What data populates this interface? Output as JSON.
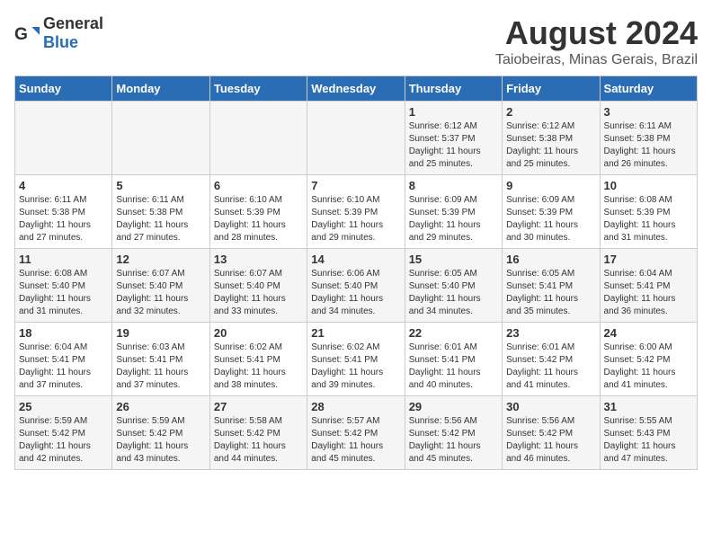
{
  "logo": {
    "general": "General",
    "blue": "Blue"
  },
  "title": {
    "month_year": "August 2024",
    "location": "Taiobeiras, Minas Gerais, Brazil"
  },
  "days_of_week": [
    "Sunday",
    "Monday",
    "Tuesday",
    "Wednesday",
    "Thursday",
    "Friday",
    "Saturday"
  ],
  "weeks": [
    [
      {
        "day": "",
        "info": ""
      },
      {
        "day": "",
        "info": ""
      },
      {
        "day": "",
        "info": ""
      },
      {
        "day": "",
        "info": ""
      },
      {
        "day": "1",
        "info": "Sunrise: 6:12 AM\nSunset: 5:37 PM\nDaylight: 11 hours\nand 25 minutes."
      },
      {
        "day": "2",
        "info": "Sunrise: 6:12 AM\nSunset: 5:38 PM\nDaylight: 11 hours\nand 25 minutes."
      },
      {
        "day": "3",
        "info": "Sunrise: 6:11 AM\nSunset: 5:38 PM\nDaylight: 11 hours\nand 26 minutes."
      }
    ],
    [
      {
        "day": "4",
        "info": "Sunrise: 6:11 AM\nSunset: 5:38 PM\nDaylight: 11 hours\nand 27 minutes."
      },
      {
        "day": "5",
        "info": "Sunrise: 6:11 AM\nSunset: 5:38 PM\nDaylight: 11 hours\nand 27 minutes."
      },
      {
        "day": "6",
        "info": "Sunrise: 6:10 AM\nSunset: 5:39 PM\nDaylight: 11 hours\nand 28 minutes."
      },
      {
        "day": "7",
        "info": "Sunrise: 6:10 AM\nSunset: 5:39 PM\nDaylight: 11 hours\nand 29 minutes."
      },
      {
        "day": "8",
        "info": "Sunrise: 6:09 AM\nSunset: 5:39 PM\nDaylight: 11 hours\nand 29 minutes."
      },
      {
        "day": "9",
        "info": "Sunrise: 6:09 AM\nSunset: 5:39 PM\nDaylight: 11 hours\nand 30 minutes."
      },
      {
        "day": "10",
        "info": "Sunrise: 6:08 AM\nSunset: 5:39 PM\nDaylight: 11 hours\nand 31 minutes."
      }
    ],
    [
      {
        "day": "11",
        "info": "Sunrise: 6:08 AM\nSunset: 5:40 PM\nDaylight: 11 hours\nand 31 minutes."
      },
      {
        "day": "12",
        "info": "Sunrise: 6:07 AM\nSunset: 5:40 PM\nDaylight: 11 hours\nand 32 minutes."
      },
      {
        "day": "13",
        "info": "Sunrise: 6:07 AM\nSunset: 5:40 PM\nDaylight: 11 hours\nand 33 minutes."
      },
      {
        "day": "14",
        "info": "Sunrise: 6:06 AM\nSunset: 5:40 PM\nDaylight: 11 hours\nand 34 minutes."
      },
      {
        "day": "15",
        "info": "Sunrise: 6:05 AM\nSunset: 5:40 PM\nDaylight: 11 hours\nand 34 minutes."
      },
      {
        "day": "16",
        "info": "Sunrise: 6:05 AM\nSunset: 5:41 PM\nDaylight: 11 hours\nand 35 minutes."
      },
      {
        "day": "17",
        "info": "Sunrise: 6:04 AM\nSunset: 5:41 PM\nDaylight: 11 hours\nand 36 minutes."
      }
    ],
    [
      {
        "day": "18",
        "info": "Sunrise: 6:04 AM\nSunset: 5:41 PM\nDaylight: 11 hours\nand 37 minutes."
      },
      {
        "day": "19",
        "info": "Sunrise: 6:03 AM\nSunset: 5:41 PM\nDaylight: 11 hours\nand 37 minutes."
      },
      {
        "day": "20",
        "info": "Sunrise: 6:02 AM\nSunset: 5:41 PM\nDaylight: 11 hours\nand 38 minutes."
      },
      {
        "day": "21",
        "info": "Sunrise: 6:02 AM\nSunset: 5:41 PM\nDaylight: 11 hours\nand 39 minutes."
      },
      {
        "day": "22",
        "info": "Sunrise: 6:01 AM\nSunset: 5:41 PM\nDaylight: 11 hours\nand 40 minutes."
      },
      {
        "day": "23",
        "info": "Sunrise: 6:01 AM\nSunset: 5:42 PM\nDaylight: 11 hours\nand 41 minutes."
      },
      {
        "day": "24",
        "info": "Sunrise: 6:00 AM\nSunset: 5:42 PM\nDaylight: 11 hours\nand 41 minutes."
      }
    ],
    [
      {
        "day": "25",
        "info": "Sunrise: 5:59 AM\nSunset: 5:42 PM\nDaylight: 11 hours\nand 42 minutes."
      },
      {
        "day": "26",
        "info": "Sunrise: 5:59 AM\nSunset: 5:42 PM\nDaylight: 11 hours\nand 43 minutes."
      },
      {
        "day": "27",
        "info": "Sunrise: 5:58 AM\nSunset: 5:42 PM\nDaylight: 11 hours\nand 44 minutes."
      },
      {
        "day": "28",
        "info": "Sunrise: 5:57 AM\nSunset: 5:42 PM\nDaylight: 11 hours\nand 45 minutes."
      },
      {
        "day": "29",
        "info": "Sunrise: 5:56 AM\nSunset: 5:42 PM\nDaylight: 11 hours\nand 45 minutes."
      },
      {
        "day": "30",
        "info": "Sunrise: 5:56 AM\nSunset: 5:42 PM\nDaylight: 11 hours\nand 46 minutes."
      },
      {
        "day": "31",
        "info": "Sunrise: 5:55 AM\nSunset: 5:43 PM\nDaylight: 11 hours\nand 47 minutes."
      }
    ]
  ]
}
